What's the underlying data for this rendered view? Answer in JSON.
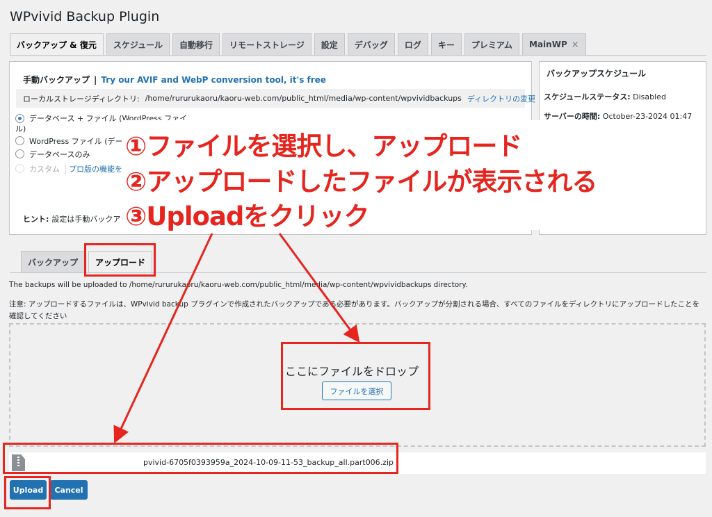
{
  "page": {
    "title": "WPvivid Backup Plugin"
  },
  "tabs": [
    {
      "label": "バックアップ & 復元",
      "active": true
    },
    {
      "label": "スケジュール"
    },
    {
      "label": "自動移行"
    },
    {
      "label": "リモートストレージ"
    },
    {
      "label": "設定"
    },
    {
      "label": "デバッグ"
    },
    {
      "label": "ログ"
    },
    {
      "label": "キー"
    },
    {
      "label": "プレミアム"
    },
    {
      "label": "MainWP",
      "close": "×"
    }
  ],
  "manual_backup": {
    "title": "手動バックアップ",
    "separator": "|",
    "promo_link": "Try our AVIF and WebP conversion tool, it's free",
    "storage_label": "ローカルストレージディレクトリ:",
    "storage_path": "/home/rururukaoru/kaoru-web.com/public_html/media/wp-content/wpvividbackups",
    "storage_change": "ディレクトリの変更",
    "options": [
      {
        "line1": "データベース + ファイル (WordPress ファイ",
        "line2": "ル)",
        "checked": true
      },
      {
        "line1": "WordPress ファイル (デー"
      },
      {
        "line1": "データベースのみ"
      },
      {
        "line1": "カスタム",
        "disabled": true,
        "link": "プロ版の機能を"
      }
    ],
    "hint_label": "ヒント:",
    "hint_text": "設定は手動バックアッ"
  },
  "schedule": {
    "title": "バックアップスケジュール",
    "status_label": "スケジュールステータス:",
    "status_value": "Disabled",
    "server_time_label": "サーバーの時間:",
    "server_time_value": "October-23-2024 01:47"
  },
  "sub_tabs": [
    {
      "label": "バックアップ"
    },
    {
      "label": "アップロード",
      "active": true
    }
  ],
  "upload": {
    "path_text": "The backups will be uploaded to /home/rururukaoru/kaoru-web.com/public_html/media/wp-content/wpvividbackups directory.",
    "notice": "注意: アップロードするファイルは、WPvivid backup プラグインで作成されたバックアップである必要があります。バックアップが分割される場合、すべてのファイルをディレクトリにアップロードしたことを確認してください",
    "drop_text": "ここにファイルをドロップ",
    "select_button": "ファイルを選択",
    "file_icon": "zip-file-icon",
    "file_name": "pvivid-6705f0393959a_2024-10-09-11-53_backup_all.part006.zip",
    "upload_button": "Upload",
    "cancel_button": "Cancel"
  },
  "annotations": {
    "step1": "①ファイルを選択し、アップロード",
    "step2": "②アップロードしたファイルが表示される",
    "step3": "③Uploadをクリック",
    "color": "#e5251e"
  },
  "colors": {
    "primary": "#2271b1",
    "link": "#2271b1",
    "annotation": "#e5251e"
  }
}
